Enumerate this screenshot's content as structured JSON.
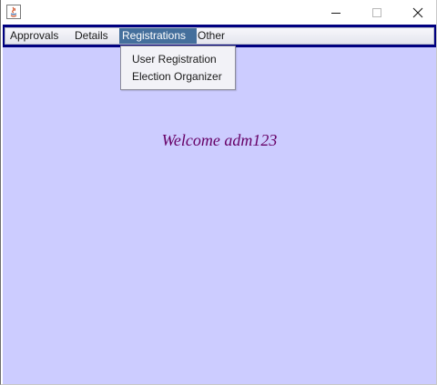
{
  "window": {
    "controls": {
      "minimize_icon": "minimize-icon",
      "maximize_icon": "maximize-icon",
      "close_icon": "close-icon"
    }
  },
  "menubar": {
    "items": [
      {
        "label": "Approvals"
      },
      {
        "label": "Details"
      },
      {
        "label": "Registrations"
      },
      {
        "label": "Other"
      }
    ],
    "active_index": 2
  },
  "dropdown": {
    "items": [
      {
        "label": "User Registration"
      },
      {
        "label": "Election Organizer"
      }
    ]
  },
  "main": {
    "welcome_text": "Welcome adm123"
  },
  "colors": {
    "menubar_frame": "#000080",
    "content_bg": "#ccccff",
    "active_menu_bg": "#446f9c",
    "welcome_text": "#660066"
  }
}
